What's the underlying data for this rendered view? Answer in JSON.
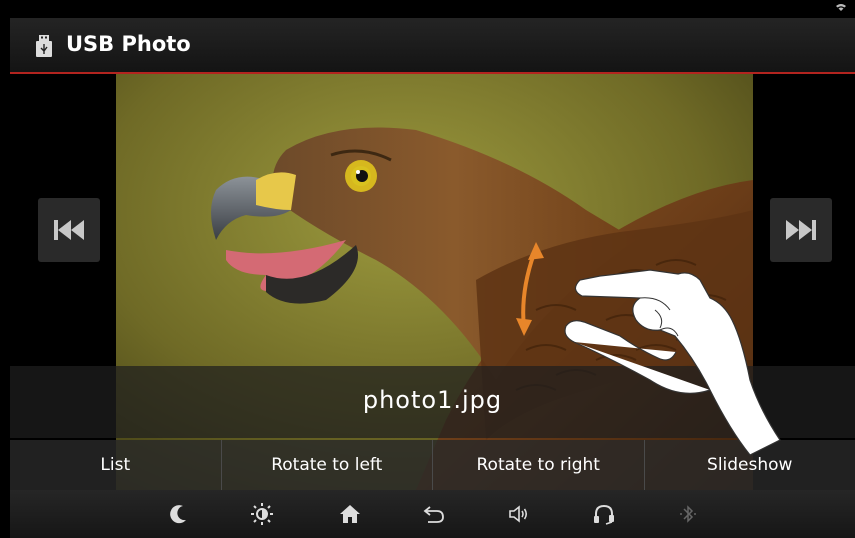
{
  "app": {
    "title": "USB Photo",
    "icon": "usb-icon"
  },
  "status": {
    "wifi_icon": "wifi-icon"
  },
  "viewer": {
    "filename": "photo1.jpg",
    "prev_icon": "skip-previous-icon",
    "next_icon": "skip-next-icon",
    "gesture_hint": "pinch-zoom-gesture-icon"
  },
  "actions": [
    {
      "label": "List"
    },
    {
      "label": "Rotate to left"
    },
    {
      "label": "Rotate to right"
    },
    {
      "label": "Slideshow"
    }
  ],
  "system_bar": {
    "icons": [
      "night-mode-icon",
      "brightness-icon",
      "home-icon",
      "back-icon",
      "volume-icon",
      "handsfree-icon",
      "bluetooth-icon"
    ]
  },
  "colors": {
    "accent": "#b3241f",
    "gesture_arrow": "#e8862a"
  }
}
